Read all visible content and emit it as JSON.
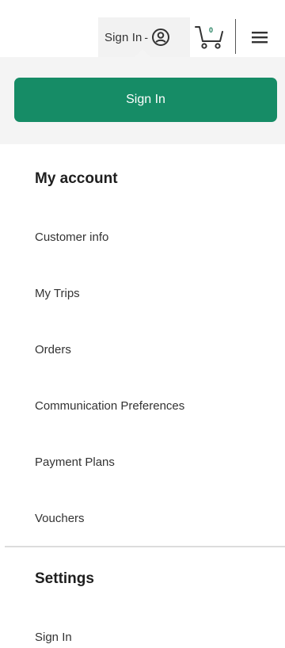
{
  "header": {
    "signin_toggle_label": "Sign In",
    "cart_count": "0",
    "user_icon": "user-circle-icon",
    "cart_icon": "shopping-cart-icon",
    "menu_icon": "hamburger-menu-icon"
  },
  "signin_panel": {
    "button_label": "Sign In"
  },
  "my_account": {
    "title": "My account",
    "items": [
      {
        "label": "Customer info"
      },
      {
        "label": "My Trips"
      },
      {
        "label": "Orders"
      },
      {
        "label": "Communication Preferences"
      },
      {
        "label": "Payment Plans"
      },
      {
        "label": "Vouchers"
      }
    ]
  },
  "settings": {
    "title": "Settings",
    "items": [
      {
        "label": "Sign In"
      }
    ]
  },
  "colors": {
    "accent": "#168c66",
    "band_background": "#f4f4f4",
    "divider": "#dcdcdc"
  }
}
